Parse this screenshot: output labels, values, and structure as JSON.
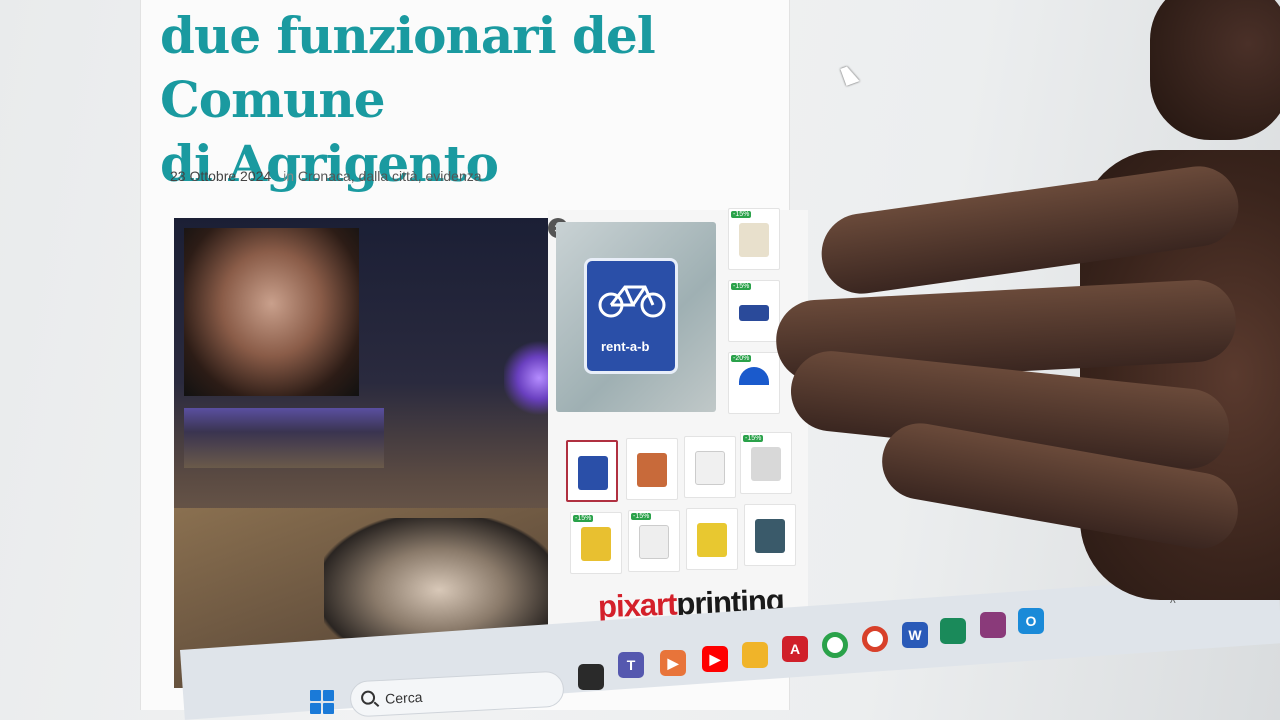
{
  "article": {
    "headline_line1": "due funzionari del Comune",
    "headline_line2": "di Agrigento",
    "date": "23 Ottobre 2024",
    "in_label": "in",
    "categories": "Cronaca, dalla città, evidenza"
  },
  "ad": {
    "close_glyph": "×",
    "sign_label": "rent-a-b",
    "brand_part1": "pixart",
    "brand_part2": "printing",
    "badges": [
      "-15%",
      "-15%",
      "-20%",
      "-15%",
      "-15%",
      "-15%"
    ]
  },
  "taskbar": {
    "search_placeholder": "Cerca",
    "apps": [
      "windows-start",
      "task-view",
      "teams",
      "media-player",
      "youtube",
      "file-explorer",
      "acrobat",
      "chrome",
      "chrome-profile",
      "word",
      "maps",
      "winrar",
      "outlook"
    ]
  },
  "tray": {
    "chevron": "^"
  },
  "colors": {
    "headline": "#1a9aa0",
    "brand_red": "#d4202a",
    "taskbar": "#dfe4ea"
  }
}
